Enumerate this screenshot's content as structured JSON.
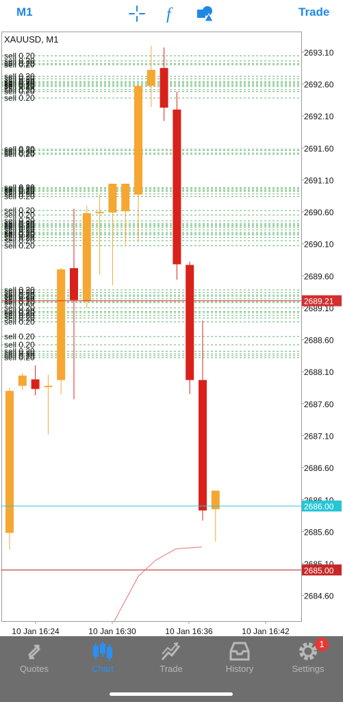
{
  "topbar": {
    "timeframe": "M1",
    "trade_label": "Trade",
    "icons": [
      "crosshair-icon",
      "function-icon",
      "shapes-icon"
    ]
  },
  "chart": {
    "symbol": "XAUUSD, M1",
    "colors": {
      "bull": "#f5a731",
      "bear": "#d9211b",
      "bid_line": "#d32f2f",
      "ask_line": "#27c6d6",
      "order_line": "#3aa34a",
      "grid": "#d9d9d9"
    }
  },
  "chart_data": {
    "type": "candlestick",
    "ylim": [
      2684.2,
      2693.42
    ],
    "y_ticks": [
      "2693.10",
      "2692.60",
      "2692.10",
      "2691.60",
      "2691.10",
      "2690.60",
      "2690.10",
      "2689.60",
      "2689.10",
      "2688.60",
      "2688.10",
      "2687.60",
      "2687.10",
      "2686.60",
      "2686.10",
      "2685.60",
      "2685.10",
      "2684.60"
    ],
    "x_labels": [
      "10 Jan 16:24",
      "10 Jan 16:30",
      "10 Jan 16:36",
      "10 Jan 16:42"
    ],
    "candles": [
      {
        "o": 2685.58,
        "h": 2687.85,
        "l": 2685.32,
        "c": 2687.8
      },
      {
        "o": 2687.88,
        "h": 2688.08,
        "l": 2687.82,
        "c": 2688.04
      },
      {
        "o": 2687.98,
        "h": 2688.2,
        "l": 2687.73,
        "c": 2687.83
      },
      {
        "o": 2687.88,
        "h": 2688.05,
        "l": 2687.12,
        "c": 2687.88
      },
      {
        "o": 2687.97,
        "h": 2689.72,
        "l": 2687.75,
        "c": 2689.7
      },
      {
        "o": 2689.72,
        "h": 2690.65,
        "l": 2687.67,
        "c": 2689.22
      },
      {
        "o": 2689.2,
        "h": 2690.7,
        "l": 2689.1,
        "c": 2690.58
      },
      {
        "o": 2690.6,
        "h": 2690.87,
        "l": 2689.62,
        "c": 2690.6
      },
      {
        "o": 2690.59,
        "h": 2691.03,
        "l": 2689.45,
        "c": 2691.04
      },
      {
        "o": 2690.61,
        "h": 2690.98,
        "l": 2690.08,
        "c": 2691.04
      },
      {
        "o": 2690.87,
        "h": 2692.58,
        "l": 2690.12,
        "c": 2692.57
      },
      {
        "o": 2692.57,
        "h": 2693.2,
        "l": 2692.24,
        "c": 2692.82
      },
      {
        "o": 2692.85,
        "h": 2693.17,
        "l": 2692.02,
        "c": 2692.23
      },
      {
        "o": 2692.2,
        "h": 2692.48,
        "l": 2689.54,
        "c": 2689.78
      },
      {
        "o": 2689.77,
        "h": 2689.82,
        "l": 2687.75,
        "c": 2687.97
      },
      {
        "o": 2687.97,
        "h": 2688.9,
        "l": 2685.77,
        "c": 2685.93
      },
      {
        "o": 2685.95,
        "h": 2686.23,
        "l": 2685.44,
        "c": 2686.24
      }
    ],
    "bid": {
      "value": 2685.0,
      "label": "2685.00"
    },
    "ask": {
      "value": 2686.0,
      "label": "2686.00"
    },
    "last_price": {
      "value": 2689.21,
      "label": "2689.21"
    },
    "order_label": "sell 0.20",
    "order_levels": [
      2693.04,
      2692.96,
      2692.92,
      2692.9,
      2692.72,
      2692.68,
      2692.64,
      2692.62,
      2692.6,
      2692.58,
      2692.56,
      2692.51,
      2692.48,
      2692.38,
      2691.58,
      2691.56,
      2691.52,
      2691.5,
      2690.98,
      2690.96,
      2690.94,
      2690.92,
      2690.88,
      2690.84,
      2690.62,
      2690.55,
      2690.46,
      2690.42,
      2690.4,
      2690.38,
      2690.36,
      2690.32,
      2690.28,
      2690.26,
      2690.24,
      2690.2,
      2690.15,
      2690.07,
      2689.38,
      2689.34,
      2689.3,
      2689.28,
      2689.24,
      2689.2,
      2689.18,
      2689.1,
      2689.04,
      2689.02,
      2688.98,
      2688.94,
      2688.88,
      2688.65,
      2688.52,
      2688.42,
      2688.38,
      2688.35,
      2688.32
    ]
  },
  "tabs": [
    {
      "label": "Quotes",
      "icon": "quotes-icon",
      "active": false
    },
    {
      "label": "Chart",
      "icon": "chart-icon",
      "active": true
    },
    {
      "label": "Trade",
      "icon": "trade-icon",
      "active": false
    },
    {
      "label": "History",
      "icon": "history-icon",
      "active": false
    },
    {
      "label": "Settings",
      "icon": "gear-icon",
      "active": false,
      "badge": "1"
    }
  ]
}
